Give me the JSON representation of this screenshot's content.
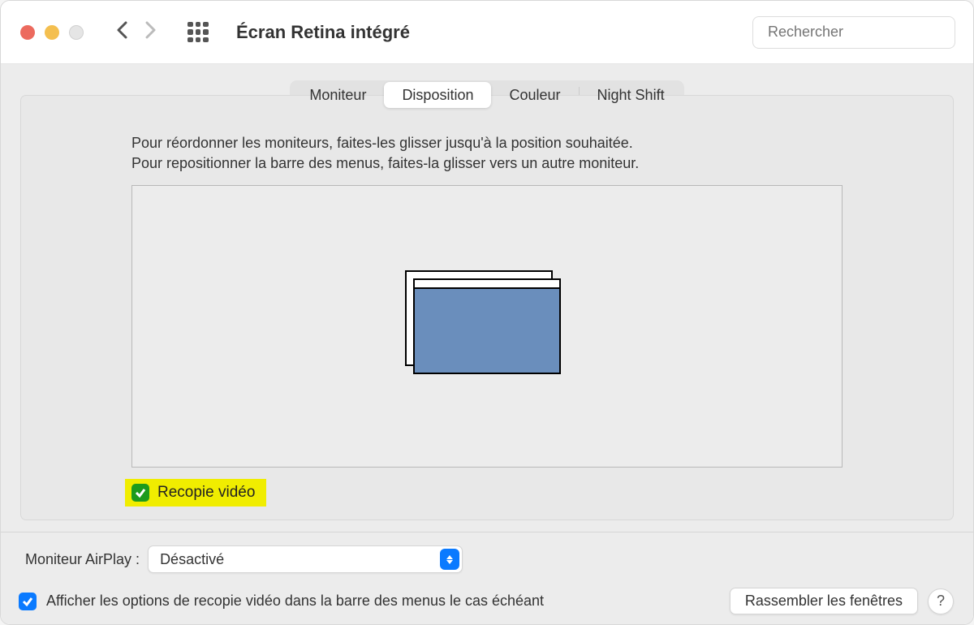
{
  "window": {
    "title": "Écran Retina intégré"
  },
  "search": {
    "placeholder": "Rechercher"
  },
  "tabs": [
    {
      "label": "Moniteur"
    },
    {
      "label": "Disposition"
    },
    {
      "label": "Couleur"
    },
    {
      "label": "Night Shift"
    }
  ],
  "active_tab_index": 1,
  "instructions": {
    "line1": "Pour réordonner les moniteurs, faites-les glisser jusqu'à la position souhaitée.",
    "line2": "Pour repositionner la barre des menus, faites-la glisser vers un autre moniteur."
  },
  "mirror": {
    "label": "Recopie vidéo",
    "checked": true,
    "highlighted": true
  },
  "airplay": {
    "label": "Moniteur AirPlay :",
    "value": "Désactivé"
  },
  "show_mirroring": {
    "label": "Afficher les options de recopie vidéo dans la barre des menus le cas échéant",
    "checked": true
  },
  "gather_button": "Rassembler les fenêtres",
  "help_button": "?"
}
